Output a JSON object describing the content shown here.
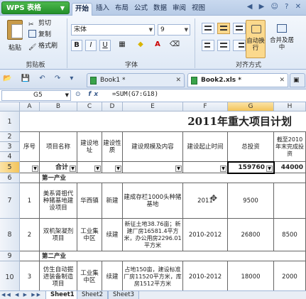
{
  "app": {
    "logo": "WPS 表格"
  },
  "ribbon_tabs": [
    "开始",
    "插入",
    "布局",
    "公式",
    "数据",
    "审阅",
    "视图"
  ],
  "ribbon": {
    "paste": "粘贴",
    "cut": "剪切",
    "copy": "复制",
    "format_painter": "格式刷",
    "group_clipboard": "剪贴板",
    "font_name": "宋体",
    "font_size": "9",
    "bold": "B",
    "italic": "I",
    "underline": "U",
    "group_font": "字体",
    "auto_wrap": "自动换行",
    "merge_center": "合并及居中",
    "group_align": "对齐方式"
  },
  "doc_tabs": [
    {
      "label": "Book1 *",
      "active": false
    },
    {
      "label": "Book2.xls *",
      "active": true
    }
  ],
  "formula_bar": {
    "cell_ref": "G5",
    "fx": "fx",
    "formula": "=SUM(G7:G18)"
  },
  "columns": [
    "A",
    "B",
    "C",
    "D",
    "E",
    "F",
    "G",
    "H"
  ],
  "rows": [
    "1",
    "2",
    "3",
    "4",
    "5",
    "6",
    "7",
    "8",
    "9",
    "10"
  ],
  "sheet": {
    "title": "2011年重大项目计划",
    "headers": {
      "a": "序号",
      "b": "项目名称",
      "c": "建设地址",
      "d": "建设性质",
      "e": "建设规模及内容",
      "f": "建设起止时间",
      "g": "总投资",
      "h": "截至2010年末完成投资"
    },
    "totals": {
      "label": "合计",
      "g": "159760",
      "h": "44000"
    },
    "section1": "第一产业",
    "row7": {
      "a": "1",
      "b": "美系肾祖代种猪基地建设项目",
      "c": "华西镇",
      "d": "新建",
      "e": "建成存栏1000头种猪基地",
      "f": "2011",
      "g": "9500",
      "h": ""
    },
    "row8": {
      "a": "2",
      "b": "双机架凝剂项目",
      "c": "工业集中区",
      "d": "续建",
      "e": "新征土地38.76亩；新建厂房16581.4平方米，办公用房2296.01平方米",
      "f": "2010-2012",
      "g": "26800",
      "h": "8500"
    },
    "section2": "第二产业",
    "row10": {
      "a": "3",
      "b": "仿生自动掘进装备制造项目",
      "c": "工业集中区",
      "d": "续建",
      "e": "占地150亩，建设标准厂房11520平方米，库房1512平方米",
      "f": "2010-2012",
      "g": "18000",
      "h": "2000"
    }
  },
  "sheet_tabs": [
    "Sheet1",
    "Sheet2",
    "Sheet3"
  ]
}
